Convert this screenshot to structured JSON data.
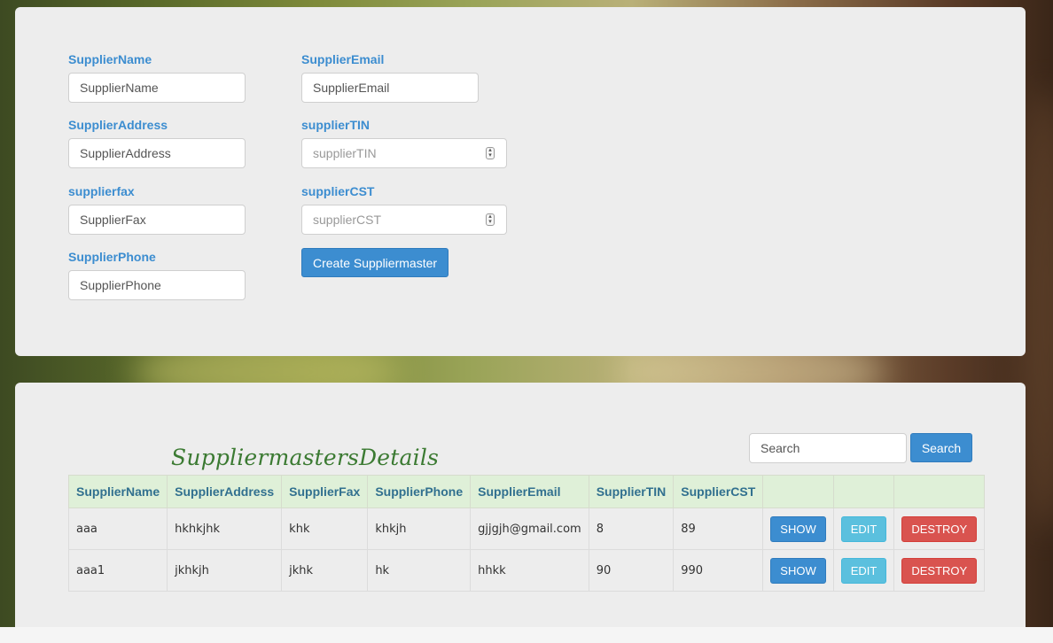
{
  "form": {
    "fields": [
      {
        "label": "SupplierName",
        "placeholder": "SupplierName"
      },
      {
        "label": "SupplierAddress",
        "placeholder": "SupplierAddress"
      },
      {
        "label": "supplierfax",
        "placeholder": "SupplierFax"
      },
      {
        "label": "SupplierPhone",
        "placeholder": "SupplierPhone"
      },
      {
        "label": "SupplierEmail",
        "placeholder": "SupplierEmail"
      },
      {
        "label": "supplierTIN",
        "placeholder": "supplierTIN"
      },
      {
        "label": "supplierCST",
        "placeholder": "supplierCST"
      }
    ],
    "submit_label": "Create Suppliermaster"
  },
  "search": {
    "placeholder": "Search",
    "button_label": "Search"
  },
  "table": {
    "title": "SuppliermastersDetails",
    "headers": [
      "SupplierName",
      "SupplierAddress",
      "SupplierFax",
      "SupplierPhone",
      "SupplierEmail",
      "SupplierTIN",
      "SupplierCST"
    ],
    "rows": [
      {
        "cells": [
          "aaa",
          "hkhkjhk",
          "khk",
          "khkjh",
          "gjjgjh@gmail.com",
          "8",
          "89"
        ]
      },
      {
        "cells": [
          "aaa1",
          "jkhkjh",
          "jkhk",
          "hk",
          "hhkk",
          "90",
          "990"
        ]
      }
    ],
    "actions": {
      "show": "SHOW",
      "edit": "EDIT",
      "destroy": "DESTROY"
    }
  },
  "colors": {
    "accent": "#3c8dd0",
    "header_bg": "#dff0d8",
    "info": "#5bc0de",
    "danger": "#d9534f"
  }
}
